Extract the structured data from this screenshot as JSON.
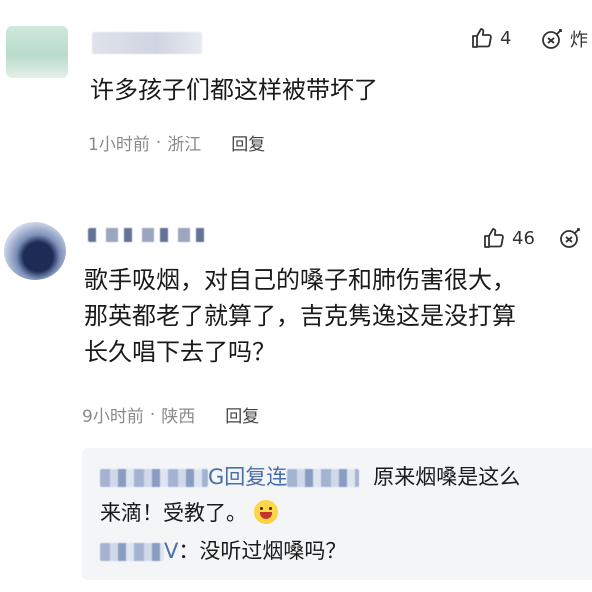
{
  "comments": [
    {
      "text_lines": [
        "许多孩子们都这样被带坏了"
      ],
      "like_count": "4",
      "boom_label": "炸",
      "time": "1小时前",
      "location": "浙江",
      "reply_label": "回复"
    },
    {
      "text_lines": [
        "歌手吸烟，对自己的嗓子和肺伤害很大，",
        "那英都老了就算了，吉克隽逸这是没打算",
        "长久唱下去了吗？"
      ],
      "like_count": "46",
      "time": "9小时前",
      "location": "陕西",
      "reply_label": "回复",
      "replies": {
        "line1_name_tail": "G回复",
        "line1_target": "连",
        "line1_text": "原来烟嗓是这么",
        "line2_text": "来滴！受教了。",
        "line3_name_tail": "V",
        "line3_text": "：没听过烟嗓吗？"
      }
    }
  ],
  "separator": "·",
  "icons": {
    "like": "thumbs-up-icon",
    "boom": "boom-icon",
    "emoji": "grinning-emoji-icon"
  },
  "colors": {
    "meta": "#8a8a8a",
    "reply_name": "#4a6ea9",
    "reply_bg": "#f4f5f7"
  }
}
